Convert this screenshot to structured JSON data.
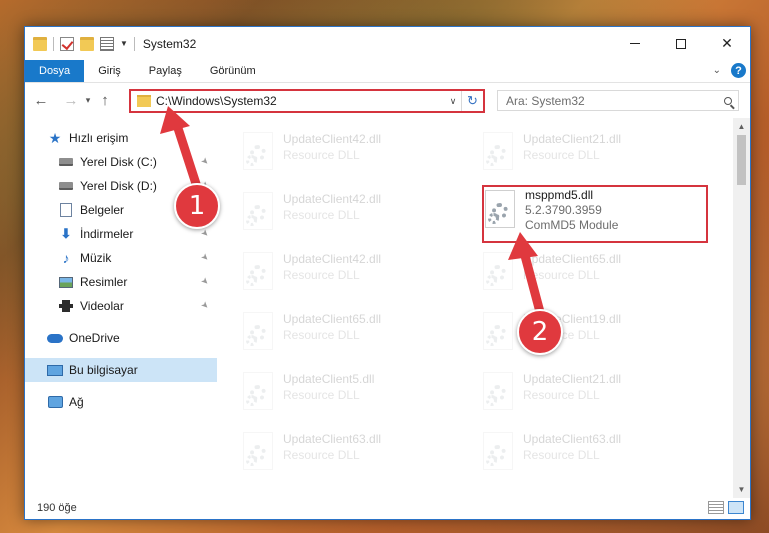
{
  "window": {
    "title": "System32"
  },
  "ribbon": {
    "tabs": [
      "Dosya",
      "Giriş",
      "Paylaş",
      "Görünüm"
    ],
    "help": "?"
  },
  "address": {
    "path": "C:\\Windows\\System32"
  },
  "search": {
    "placeholder": "Ara: System32"
  },
  "sidebar": {
    "items": [
      {
        "label": "Hızlı erişim"
      },
      {
        "label": "Yerel Disk (C:)"
      },
      {
        "label": "Yerel Disk (D:)"
      },
      {
        "label": "Belgeler"
      },
      {
        "label": "İndirmeler"
      },
      {
        "label": "Müzik"
      },
      {
        "label": "Resimler"
      },
      {
        "label": "Videolar"
      },
      {
        "label": "OneDrive"
      },
      {
        "label": "Bu bilgisayar"
      },
      {
        "label": "Ağ"
      }
    ]
  },
  "files": [
    {
      "name": "UpdateClient42.dll",
      "sub": "Resource DLL"
    },
    {
      "name": "UpdateClient21.dll",
      "sub": "Resource DLL"
    },
    {
      "name": "UpdateClient42.dll",
      "sub": "Resource DLL"
    },
    {
      "name": "msppmd5.dll",
      "line2": "5.2.3790.3959",
      "line3": "ComMD5 Module"
    },
    {
      "name": "UpdateClient42.dll",
      "sub": "Resource DLL"
    },
    {
      "name": "UpdateClient65.dll",
      "sub": "Resource DLL"
    },
    {
      "name": "UpdateClient65.dll",
      "sub": "Resource DLL"
    },
    {
      "name": "UpdateClient19.dll",
      "sub": "Resource DLL"
    },
    {
      "name": "UpdateClient5.dll",
      "sub": "Resource DLL"
    },
    {
      "name": "UpdateClient21.dll",
      "sub": "Resource DLL"
    },
    {
      "name": "UpdateClient63.dll",
      "sub": "Resource DLL"
    },
    {
      "name": "UpdateClient63.dll",
      "sub": "Resource DLL"
    }
  ],
  "status": {
    "count": "190 öğe"
  },
  "annotations": {
    "step1": "1",
    "step2": "2"
  },
  "colors": {
    "accent": "#1979ca",
    "highlight": "#d5343e"
  }
}
